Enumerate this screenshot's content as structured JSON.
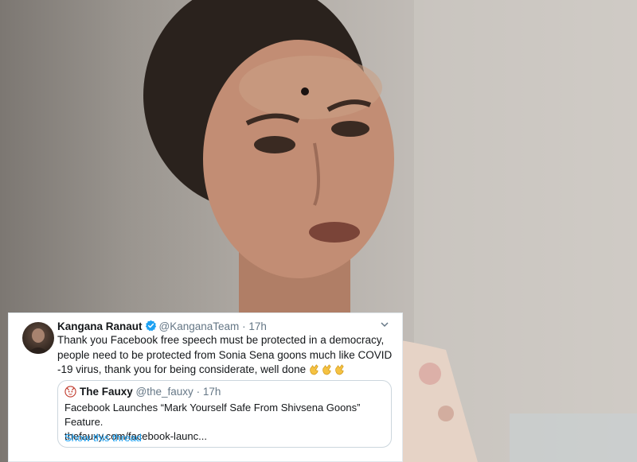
{
  "tweet": {
    "author_name": "Kangana Ranaut",
    "handle": "@KanganaTeam",
    "separator": "·",
    "time": "17h",
    "verified_icon": "verified-badge-icon",
    "text": "Thank you Facebook free speech must be protected in a democracy, people need to be protected from Sonia Sena goons much like COVID -19 virus, thank you for being considerate, well done",
    "emoji_icon": "clapping-hands-icon",
    "emoji_count": 3,
    "quoted": {
      "author_name": "The Fauxy",
      "handle": "@the_fauxy",
      "separator": "·",
      "time": "17h",
      "line1": "Facebook Launches “Mark Yourself Safe From Shivsena Goons” Feature.",
      "line2": "thefauxy.com/facebook-launc...",
      "thread_link": "Show this thread"
    }
  },
  "colors": {
    "link": "#1da1f2",
    "verified": "#1da1f2",
    "secondary_text": "#657786"
  }
}
